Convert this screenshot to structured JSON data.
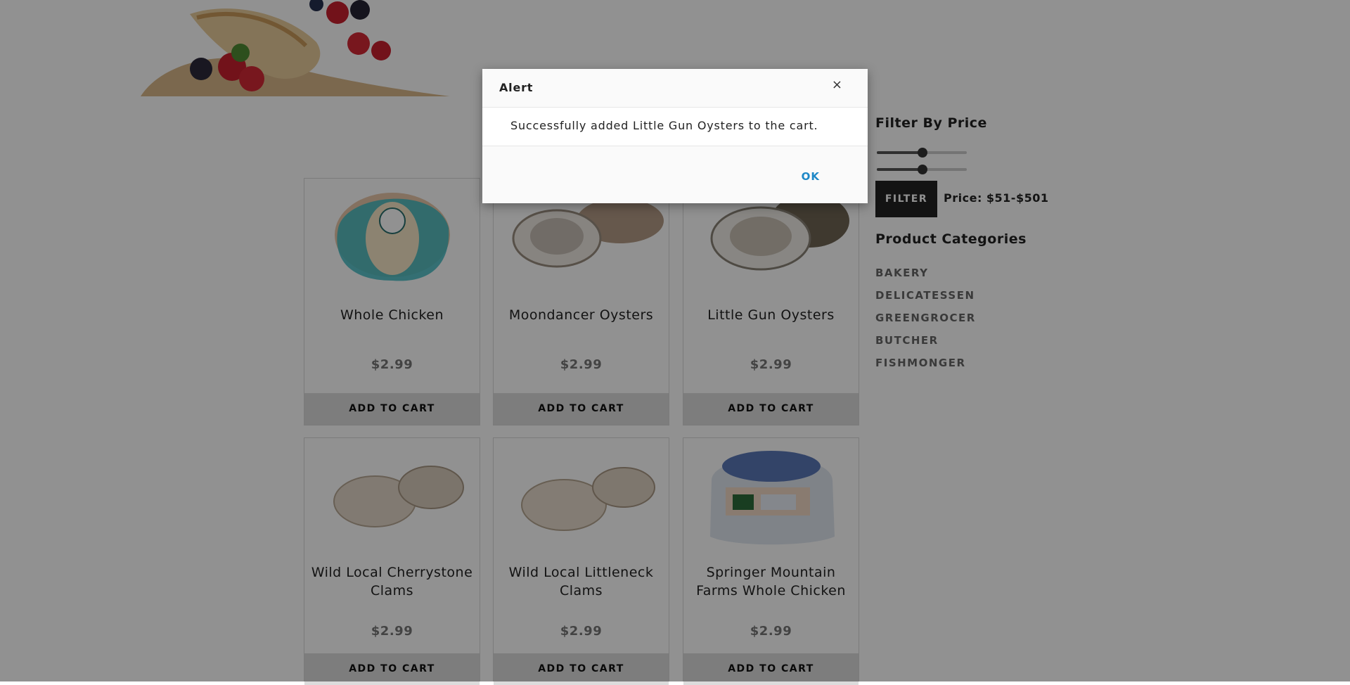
{
  "products": [
    {
      "name": "Whole Chicken",
      "price": "$2.99",
      "button": "ADD TO CART"
    },
    {
      "name": "Moondancer Oysters",
      "price": "$2.99",
      "button": "ADD TO CART"
    },
    {
      "name": "Little Gun Oysters",
      "price": "$2.99",
      "button": "ADD TO CART"
    },
    {
      "name": "Wild Local Cherrystone Clams",
      "price": "$2.99",
      "button": "ADD TO CART"
    },
    {
      "name": "Wild Local Littleneck Clams",
      "price": "$2.99",
      "button": "ADD TO CART"
    },
    {
      "name": "Springer Mountain Farms Whole Chicken",
      "price": "$2.99",
      "button": "ADD TO CART"
    }
  ],
  "sidebar": {
    "filter_title": "Filter By Price",
    "filter_button": "FILTER",
    "price_range": "Price: $51-$501",
    "categories_title": "Product Categories",
    "categories": [
      "BAKERY",
      "DELICATESSEN",
      "GREENGROCER",
      "BUTCHER",
      "FISHMONGER"
    ]
  },
  "modal": {
    "title": "Alert",
    "close": "×",
    "message": "Successfully added Little Gun Oysters to the cart.",
    "ok": "OK"
  }
}
